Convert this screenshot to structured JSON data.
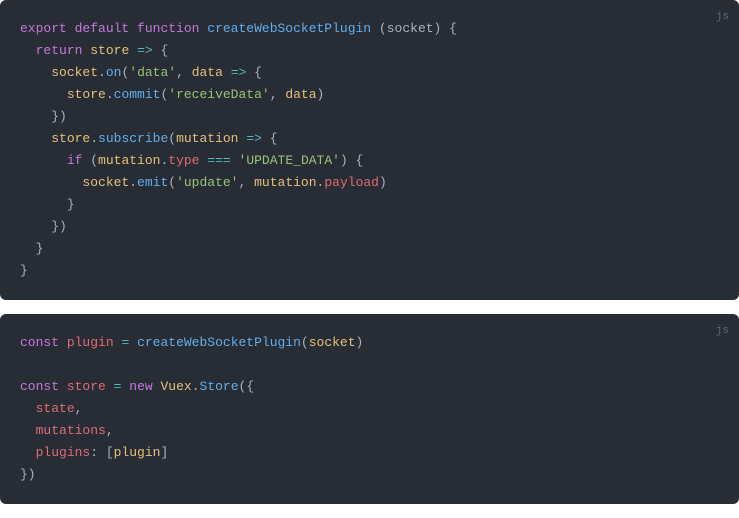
{
  "block1": {
    "lang": "js",
    "l1": {
      "kw_export": "export",
      "kw_default": "default",
      "kw_function": "function",
      "fn": "createWebSocketPlugin",
      "param": "socket"
    },
    "l2": {
      "kw_return": "return",
      "var": "store",
      "op": "=>"
    },
    "l3": {
      "obj": "socket",
      "method": "on",
      "str": "'data'",
      "param": "data",
      "op": "=>"
    },
    "l4": {
      "obj": "store",
      "method": "commit",
      "str": "'receiveData'",
      "arg": "data"
    },
    "l5": {
      "close": "})"
    },
    "l6": {
      "obj": "store",
      "method": "subscribe",
      "param": "mutation",
      "op": "=>"
    },
    "l7": {
      "kw_if": "if",
      "obj": "mutation",
      "prop": "type",
      "op": "===",
      "str": "'UPDATE_DATA'"
    },
    "l8": {
      "obj": "socket",
      "method": "emit",
      "str": "'update'",
      "arg_obj": "mutation",
      "arg_prop": "payload"
    },
    "l9": {
      "close": "}"
    },
    "l10": {
      "close": "})"
    },
    "l11": {
      "close": "}"
    },
    "l12": {
      "close": "}"
    }
  },
  "block2": {
    "lang": "js",
    "l1": {
      "kw_const": "const",
      "var": "plugin",
      "fn": "createWebSocketPlugin",
      "arg": "socket"
    },
    "l3": {
      "kw_const": "const",
      "var": "store",
      "kw_new": "new",
      "cls": "Vuex",
      "method": "Store"
    },
    "l4": {
      "prop": "state"
    },
    "l5": {
      "prop": "mutations"
    },
    "l6": {
      "prop": "plugins",
      "val": "plugin"
    },
    "l7": {
      "close": "})"
    }
  }
}
